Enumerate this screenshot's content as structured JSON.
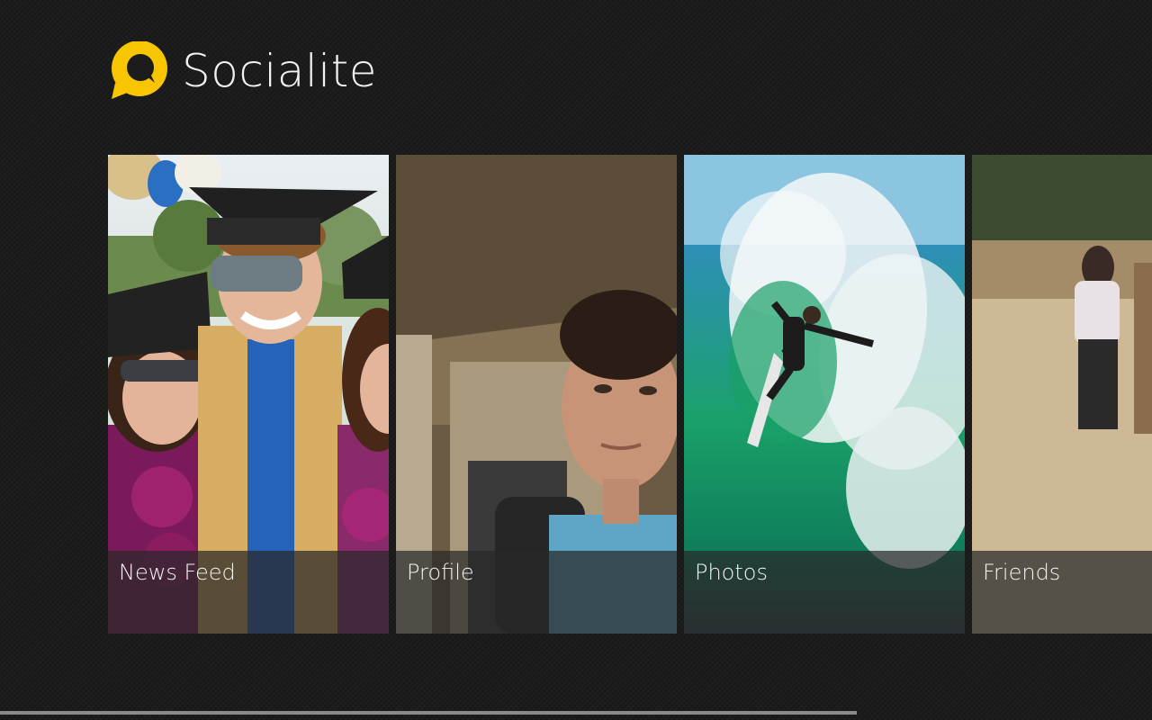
{
  "app": {
    "title": "Socialite",
    "logo_icon": "speech-bubble-logo-icon",
    "accent_color": "#f7c600"
  },
  "tiles": [
    {
      "label": "News Feed",
      "image": "graduation-group-photo"
    },
    {
      "label": "Profile",
      "image": "profile-portrait-photo"
    },
    {
      "label": "Photos",
      "image": "surfer-wave-photo"
    },
    {
      "label": "Friends",
      "image": "friends-person-photo"
    }
  ],
  "scrollbar": {
    "position": 0
  }
}
